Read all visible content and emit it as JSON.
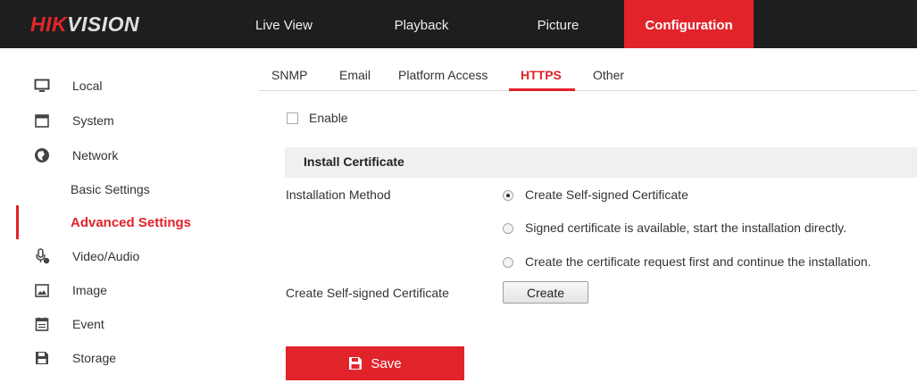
{
  "brand": {
    "logo_red": "HIK",
    "logo_white": "VISION"
  },
  "nav": [
    {
      "label": "Live View"
    },
    {
      "label": "Playback"
    },
    {
      "label": "Picture"
    },
    {
      "label": "Configuration",
      "active": true
    }
  ],
  "sidebar": {
    "items": [
      {
        "label": "Local",
        "icon": "monitor-icon"
      },
      {
        "label": "System",
        "icon": "window-icon"
      },
      {
        "label": "Network",
        "icon": "globe-icon"
      },
      {
        "label": "Basic Settings",
        "sub": true
      },
      {
        "label": "Advanced Settings",
        "sub": true,
        "active": true
      },
      {
        "label": "Video/Audio",
        "icon": "microphone-icon"
      },
      {
        "label": "Image",
        "icon": "image-icon"
      },
      {
        "label": "Event",
        "icon": "calendar-icon"
      },
      {
        "label": "Storage",
        "icon": "floppy-disk-icon"
      }
    ]
  },
  "tabs": [
    {
      "label": "SNMP"
    },
    {
      "label": "Email"
    },
    {
      "label": "Platform Access"
    },
    {
      "label": "HTTPS",
      "active": true
    },
    {
      "label": "Other"
    }
  ],
  "form": {
    "enable_label": "Enable",
    "enable_checked": false,
    "section_title": "Install Certificate",
    "installation_method_label": "Installation Method",
    "options": [
      {
        "label": "Create Self-signed Certificate",
        "checked": true
      },
      {
        "label": "Signed certificate is available, start the installation directly.",
        "checked": false
      },
      {
        "label": "Create the certificate request first and continue the installation.",
        "checked": false
      }
    ],
    "create_row_label": "Create Self-signed Certificate",
    "create_button": "Create",
    "save_button": "Save"
  },
  "colors": {
    "accent": "#e1232a",
    "header_bg": "#1e1e1e",
    "section_bg": "#f0f0f0"
  }
}
